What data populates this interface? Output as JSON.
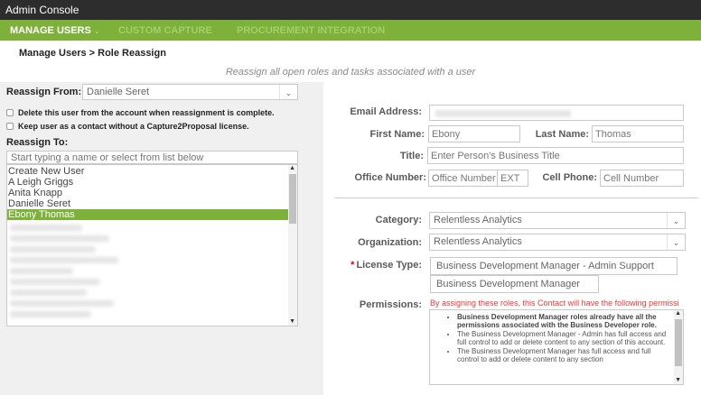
{
  "window": {
    "title": "Admin Console"
  },
  "nav": {
    "items": [
      {
        "label": "MANAGE USERS",
        "active": true
      },
      {
        "label": "CUSTOM CAPTURE",
        "active": false
      },
      {
        "label": "PROCUREMENT INTEGRATION",
        "active": false
      }
    ]
  },
  "breadcrumb": "Manage Users > Role Reassign",
  "subtitle": "Reassign all open roles and tasks associated with a user",
  "reassign_from": {
    "label": "Reassign From:",
    "value": "Danielle Seret"
  },
  "checkboxes": [
    {
      "label": "Delete this user from the account when reassignment is complete.",
      "checked": false
    },
    {
      "label": "Keep user as a contact without a Capture2Proposal license.",
      "checked": false
    }
  ],
  "reassign_to": {
    "label": "Reassign To:",
    "search_placeholder": "Start typing a name or select from list below",
    "options": [
      {
        "label": "Create New User",
        "selected": false
      },
      {
        "label": "A Leigh Griggs",
        "selected": false
      },
      {
        "label": "Anita Knapp",
        "selected": false
      },
      {
        "label": "Danielle Seret",
        "selected": false
      },
      {
        "label": "Ebony Thomas",
        "selected": true
      }
    ]
  },
  "form": {
    "email": {
      "label": "Email Address:",
      "value": ""
    },
    "first_name": {
      "label": "First Name:",
      "value": "Ebony"
    },
    "last_name": {
      "label": "Last Name:",
      "value": "Thomas"
    },
    "title": {
      "label": "Title:",
      "placeholder": "Enter Person's Business Title"
    },
    "office_number": {
      "label": "Office Number:",
      "placeholder": "Office Number",
      "ext_placeholder": "EXT"
    },
    "cell_phone": {
      "label": "Cell Phone:",
      "placeholder": "Cell Number"
    },
    "category": {
      "label": "Category:",
      "value": "Relentless Analytics"
    },
    "organization": {
      "label": "Organization:",
      "value": "Relentless Analytics"
    },
    "license_type": {
      "label": "License Type:",
      "required_marker": "*",
      "values": [
        "Business Development Manager - Admin Support",
        "Business Development Manager"
      ]
    },
    "permissions": {
      "label": "Permissions:",
      "warning": "By assigning these roles, this Contact will have the following permissi",
      "items": [
        {
          "text": "Business Development Manager roles already have all the permissions associated with the Business Developer role.",
          "bold": true
        },
        {
          "text": "The Business Development Manager - Admin has full access and full control to add or delete content to any section of this account.",
          "bold": false
        },
        {
          "text": "The Business Development Manager has full access and full control to add or delete content to any section",
          "bold": false
        }
      ]
    }
  },
  "colors": {
    "titlebar": "#2d2d2d",
    "nav_green": "#7db13a",
    "selection_green": "#7db13a",
    "warning_red": "#e03a3a"
  }
}
